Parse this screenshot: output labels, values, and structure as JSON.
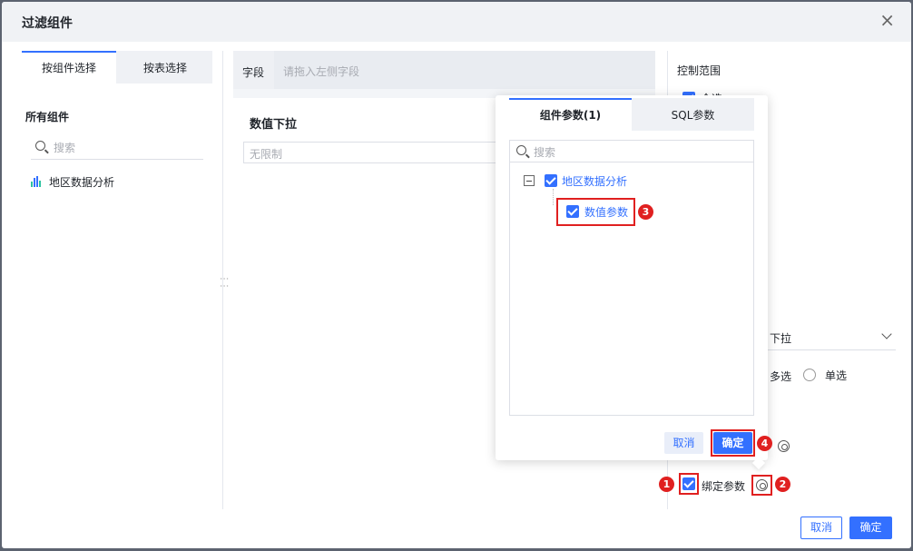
{
  "dialog": {
    "title": "过滤组件",
    "close_icon": "close-icon"
  },
  "left": {
    "tabs": [
      {
        "label": "按组件选择",
        "active": true
      },
      {
        "label": "按表选择",
        "active": false
      }
    ],
    "all_components_label": "所有组件",
    "search_placeholder": "搜索",
    "components": [
      {
        "label": "地区数据分析",
        "icon": "bar-chart-icon"
      }
    ]
  },
  "middle": {
    "field_label": "字段",
    "field_placeholder": "请拖入左侧字段",
    "preview_title": "数值下拉",
    "preview_placeholder": "无限制"
  },
  "right": {
    "control_range_label": "控制范围",
    "select_all_label": "全选",
    "type_value": "下拉",
    "mode_multi_label": "多选",
    "mode_single_label": "单选",
    "bind_param_label": "绑定参数"
  },
  "popover": {
    "tabs": [
      {
        "label": "组件参数(1)",
        "active": true
      },
      {
        "label": "SQL参数",
        "active": false
      }
    ],
    "search_placeholder": "搜索",
    "tree": {
      "parent_label": "地区数据分析",
      "child_label": "数值参数"
    },
    "cancel_label": "取消",
    "ok_label": "确定"
  },
  "annotations": {
    "badge1": "1",
    "badge2": "2",
    "badge3": "3",
    "badge4": "4"
  },
  "footer": {
    "cancel_label": "取消",
    "ok_label": "确定"
  },
  "colors": {
    "accent": "#3370ff",
    "highlight": "#e02020"
  }
}
